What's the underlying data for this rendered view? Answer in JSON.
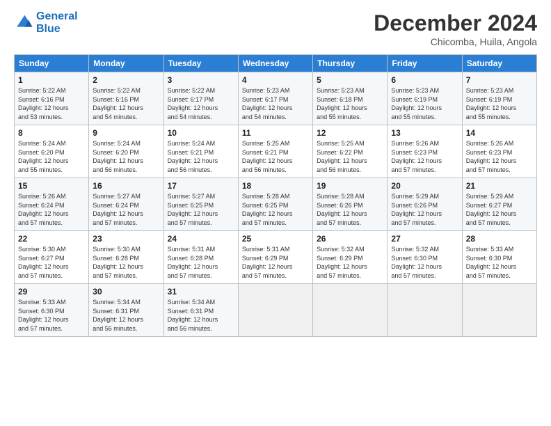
{
  "logo": {
    "line1": "General",
    "line2": "Blue"
  },
  "title": "December 2024",
  "subtitle": "Chicomba, Huila, Angola",
  "headers": [
    "Sunday",
    "Monday",
    "Tuesday",
    "Wednesday",
    "Thursday",
    "Friday",
    "Saturday"
  ],
  "rows": [
    [
      {
        "day": "1",
        "info": "Sunrise: 5:22 AM\nSunset: 6:16 PM\nDaylight: 12 hours\nand 53 minutes."
      },
      {
        "day": "2",
        "info": "Sunrise: 5:22 AM\nSunset: 6:16 PM\nDaylight: 12 hours\nand 54 minutes."
      },
      {
        "day": "3",
        "info": "Sunrise: 5:22 AM\nSunset: 6:17 PM\nDaylight: 12 hours\nand 54 minutes."
      },
      {
        "day": "4",
        "info": "Sunrise: 5:23 AM\nSunset: 6:17 PM\nDaylight: 12 hours\nand 54 minutes."
      },
      {
        "day": "5",
        "info": "Sunrise: 5:23 AM\nSunset: 6:18 PM\nDaylight: 12 hours\nand 55 minutes."
      },
      {
        "day": "6",
        "info": "Sunrise: 5:23 AM\nSunset: 6:19 PM\nDaylight: 12 hours\nand 55 minutes."
      },
      {
        "day": "7",
        "info": "Sunrise: 5:23 AM\nSunset: 6:19 PM\nDaylight: 12 hours\nand 55 minutes."
      }
    ],
    [
      {
        "day": "8",
        "info": "Sunrise: 5:24 AM\nSunset: 6:20 PM\nDaylight: 12 hours\nand 55 minutes."
      },
      {
        "day": "9",
        "info": "Sunrise: 5:24 AM\nSunset: 6:20 PM\nDaylight: 12 hours\nand 56 minutes."
      },
      {
        "day": "10",
        "info": "Sunrise: 5:24 AM\nSunset: 6:21 PM\nDaylight: 12 hours\nand 56 minutes."
      },
      {
        "day": "11",
        "info": "Sunrise: 5:25 AM\nSunset: 6:21 PM\nDaylight: 12 hours\nand 56 minutes."
      },
      {
        "day": "12",
        "info": "Sunrise: 5:25 AM\nSunset: 6:22 PM\nDaylight: 12 hours\nand 56 minutes."
      },
      {
        "day": "13",
        "info": "Sunrise: 5:26 AM\nSunset: 6:23 PM\nDaylight: 12 hours\nand 57 minutes."
      },
      {
        "day": "14",
        "info": "Sunrise: 5:26 AM\nSunset: 6:23 PM\nDaylight: 12 hours\nand 57 minutes."
      }
    ],
    [
      {
        "day": "15",
        "info": "Sunrise: 5:26 AM\nSunset: 6:24 PM\nDaylight: 12 hours\nand 57 minutes."
      },
      {
        "day": "16",
        "info": "Sunrise: 5:27 AM\nSunset: 6:24 PM\nDaylight: 12 hours\nand 57 minutes."
      },
      {
        "day": "17",
        "info": "Sunrise: 5:27 AM\nSunset: 6:25 PM\nDaylight: 12 hours\nand 57 minutes."
      },
      {
        "day": "18",
        "info": "Sunrise: 5:28 AM\nSunset: 6:25 PM\nDaylight: 12 hours\nand 57 minutes."
      },
      {
        "day": "19",
        "info": "Sunrise: 5:28 AM\nSunset: 6:26 PM\nDaylight: 12 hours\nand 57 minutes."
      },
      {
        "day": "20",
        "info": "Sunrise: 5:29 AM\nSunset: 6:26 PM\nDaylight: 12 hours\nand 57 minutes."
      },
      {
        "day": "21",
        "info": "Sunrise: 5:29 AM\nSunset: 6:27 PM\nDaylight: 12 hours\nand 57 minutes."
      }
    ],
    [
      {
        "day": "22",
        "info": "Sunrise: 5:30 AM\nSunset: 6:27 PM\nDaylight: 12 hours\nand 57 minutes."
      },
      {
        "day": "23",
        "info": "Sunrise: 5:30 AM\nSunset: 6:28 PM\nDaylight: 12 hours\nand 57 minutes."
      },
      {
        "day": "24",
        "info": "Sunrise: 5:31 AM\nSunset: 6:28 PM\nDaylight: 12 hours\nand 57 minutes."
      },
      {
        "day": "25",
        "info": "Sunrise: 5:31 AM\nSunset: 6:29 PM\nDaylight: 12 hours\nand 57 minutes."
      },
      {
        "day": "26",
        "info": "Sunrise: 5:32 AM\nSunset: 6:29 PM\nDaylight: 12 hours\nand 57 minutes."
      },
      {
        "day": "27",
        "info": "Sunrise: 5:32 AM\nSunset: 6:30 PM\nDaylight: 12 hours\nand 57 minutes."
      },
      {
        "day": "28",
        "info": "Sunrise: 5:33 AM\nSunset: 6:30 PM\nDaylight: 12 hours\nand 57 minutes."
      }
    ],
    [
      {
        "day": "29",
        "info": "Sunrise: 5:33 AM\nSunset: 6:30 PM\nDaylight: 12 hours\nand 57 minutes."
      },
      {
        "day": "30",
        "info": "Sunrise: 5:34 AM\nSunset: 6:31 PM\nDaylight: 12 hours\nand 56 minutes."
      },
      {
        "day": "31",
        "info": "Sunrise: 5:34 AM\nSunset: 6:31 PM\nDaylight: 12 hours\nand 56 minutes."
      },
      {
        "day": "",
        "info": ""
      },
      {
        "day": "",
        "info": ""
      },
      {
        "day": "",
        "info": ""
      },
      {
        "day": "",
        "info": ""
      }
    ]
  ]
}
